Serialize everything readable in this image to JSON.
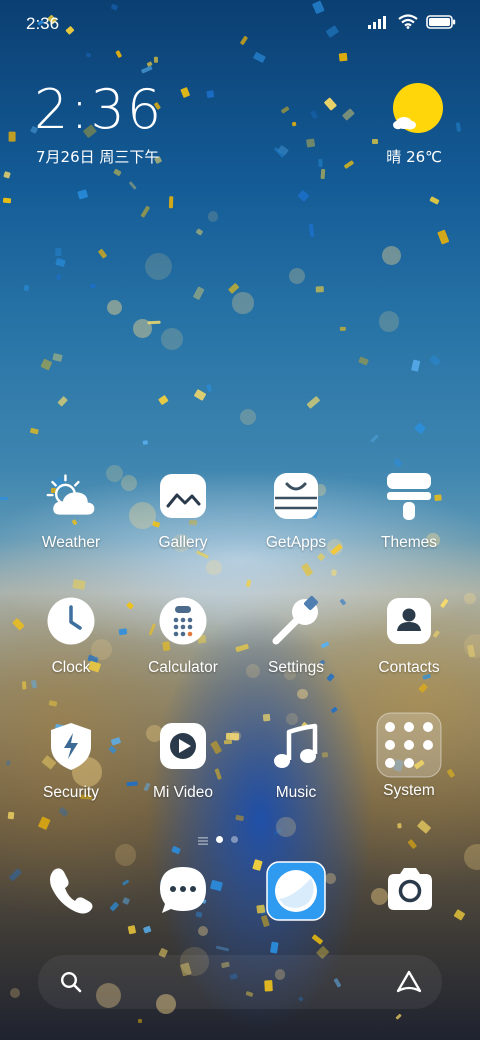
{
  "status_bar": {
    "time": "2:36",
    "icons": [
      "signal-icon",
      "wifi-icon",
      "battery-icon"
    ]
  },
  "clock_widget": {
    "time": "2:36",
    "date": "7月26日 周三下午"
  },
  "weather_widget": {
    "text": "晴 26℃",
    "icon": "partly-sunny-icon",
    "sun_color": "#FFD60A"
  },
  "home_apps": [
    {
      "label": "Weather",
      "icon": "weather-icon"
    },
    {
      "label": "Gallery",
      "icon": "gallery-icon"
    },
    {
      "label": "GetApps",
      "icon": "getapps-icon"
    },
    {
      "label": "Themes",
      "icon": "themes-icon"
    },
    {
      "label": "Clock",
      "icon": "clock-icon"
    },
    {
      "label": "Calculator",
      "icon": "calculator-icon"
    },
    {
      "label": "Settings",
      "icon": "settings-icon"
    },
    {
      "label": "Contacts",
      "icon": "contacts-icon"
    },
    {
      "label": "Security",
      "icon": "security-icon"
    },
    {
      "label": "Mi Video",
      "icon": "mi-video-icon"
    },
    {
      "label": "Music",
      "icon": "music-icon"
    },
    {
      "label": "System",
      "icon": "system-folder-icon"
    }
  ],
  "page_indicator": {
    "pages": 2,
    "current": 1
  },
  "dock": [
    {
      "icon": "phone-icon"
    },
    {
      "icon": "messages-icon"
    },
    {
      "icon": "browser-icon",
      "accent": "#2E9BF0"
    },
    {
      "icon": "camera-icon"
    }
  ],
  "search_bar": {
    "left_icon": "search-icon",
    "right_icon": "assistant-icon"
  }
}
